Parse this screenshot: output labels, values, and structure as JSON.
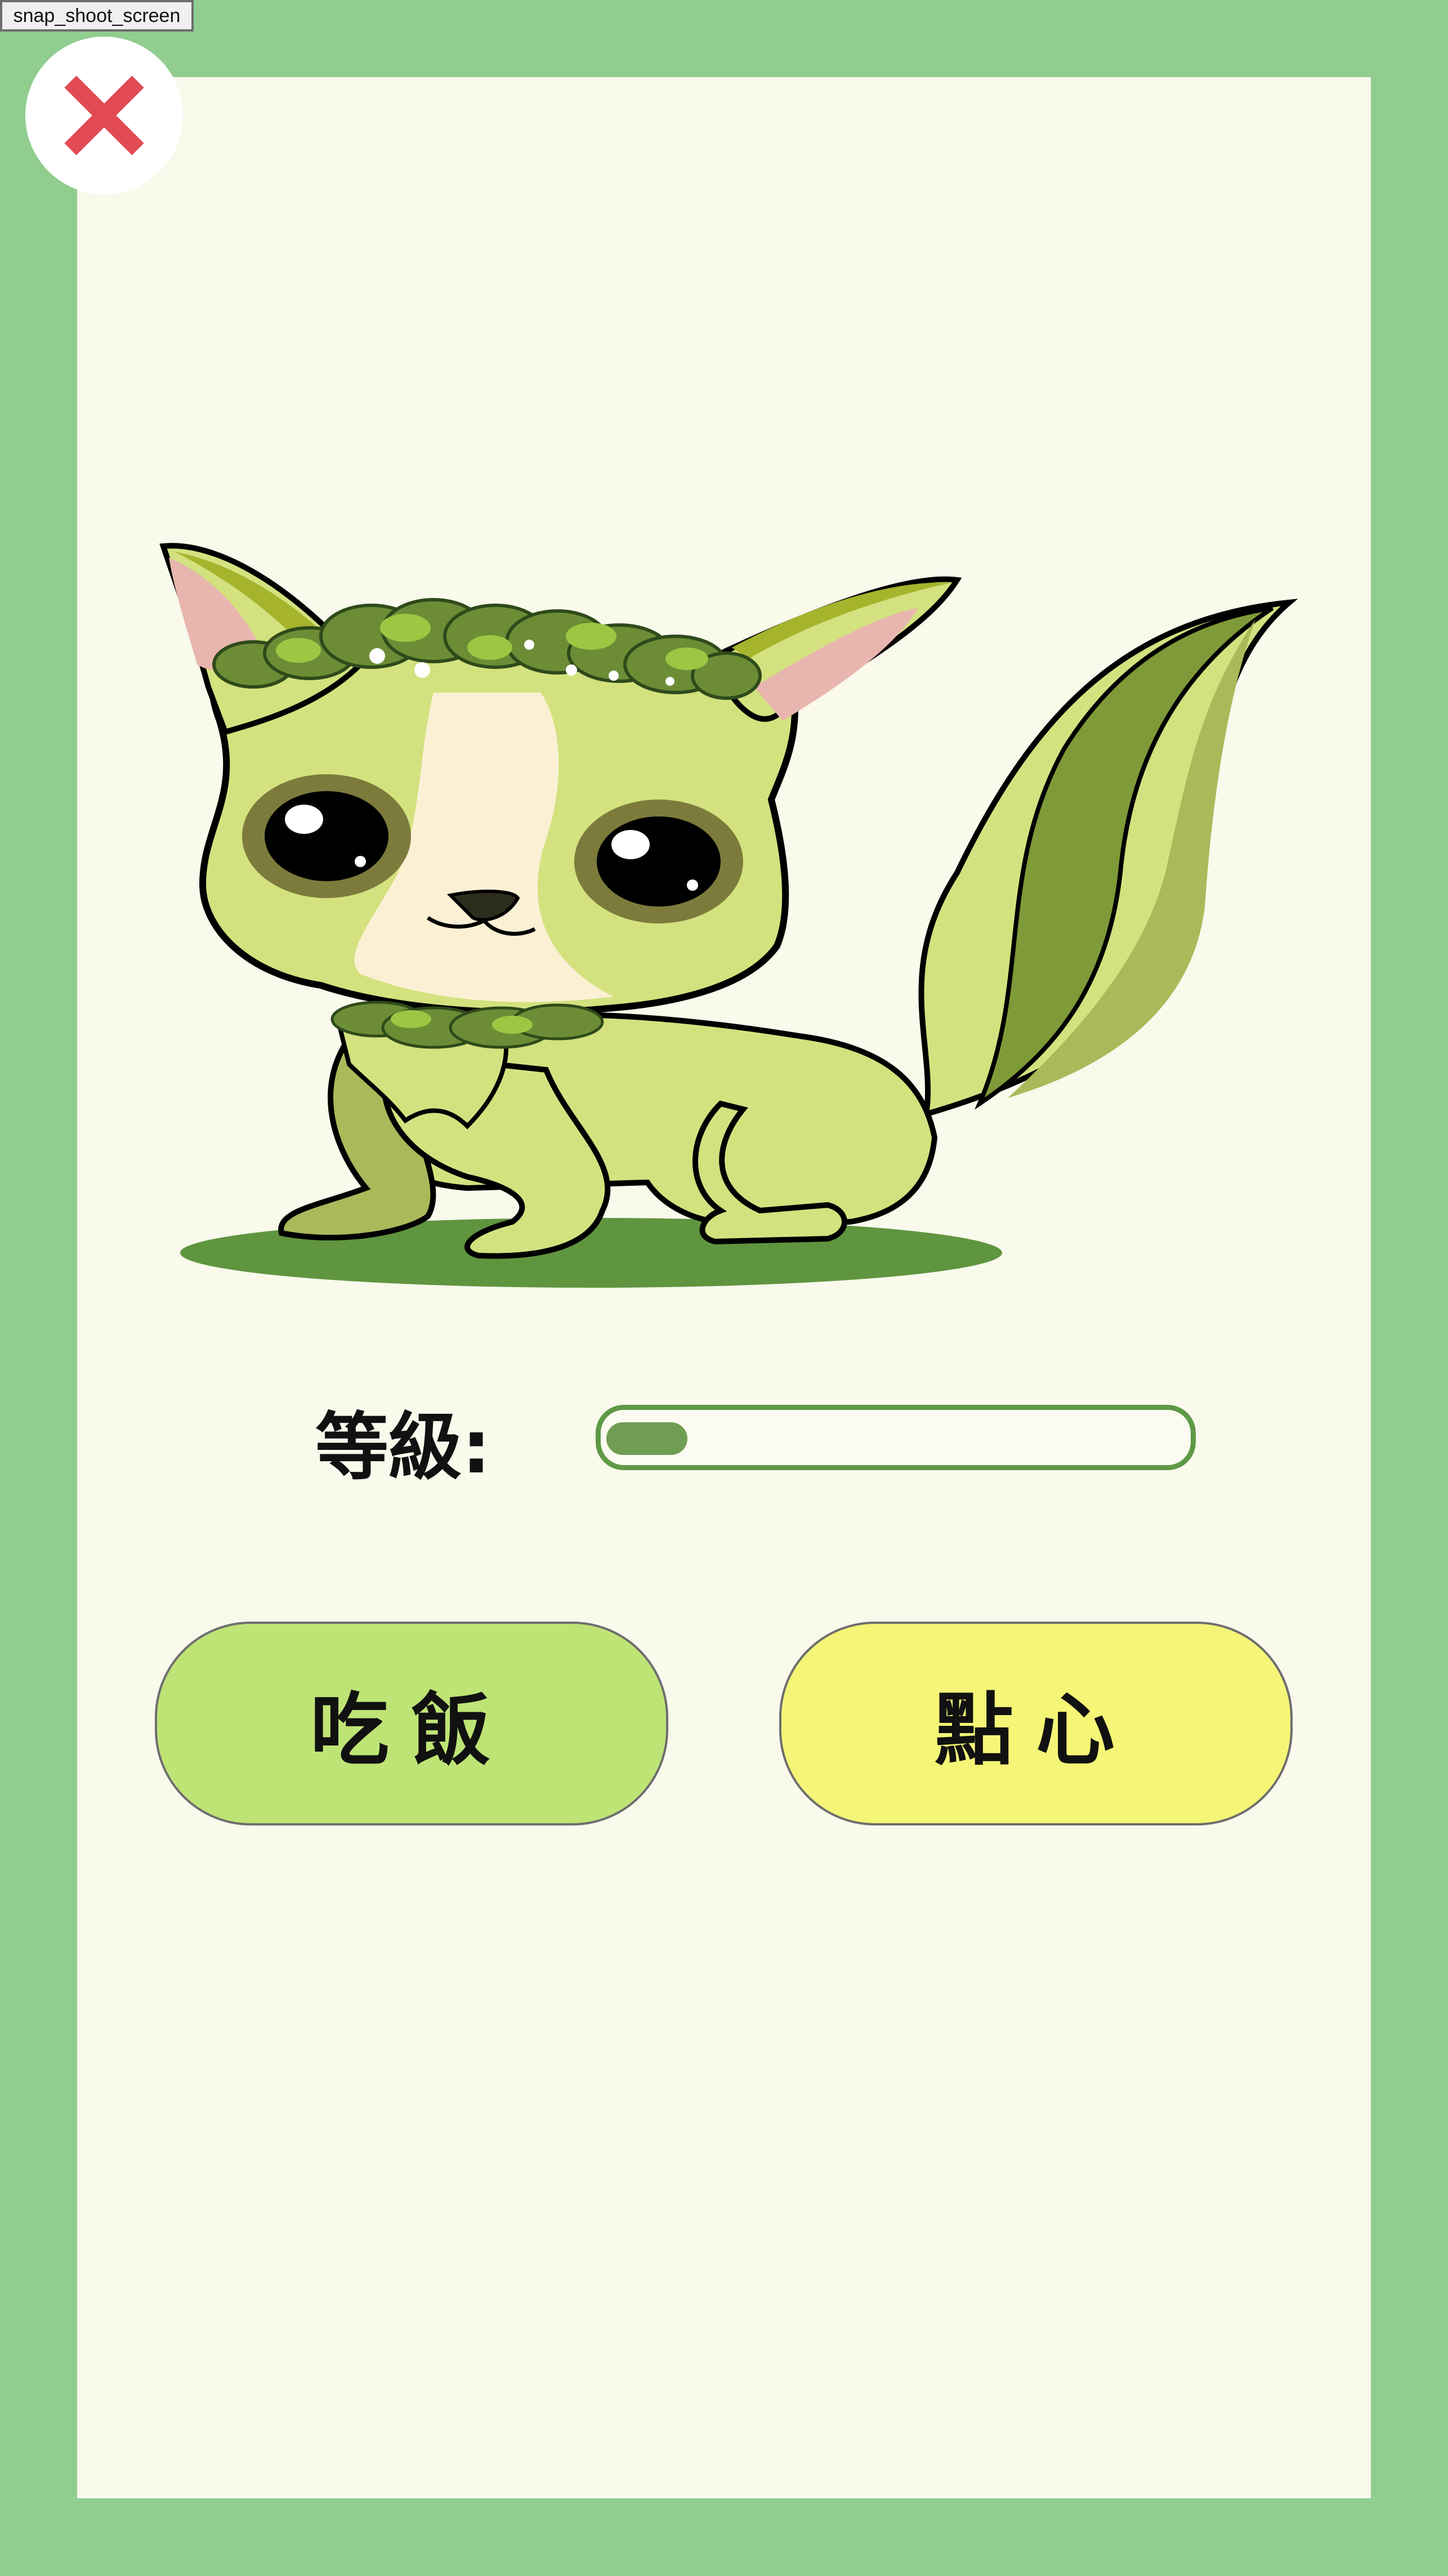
{
  "toolbar": {
    "snapshot_label": "snap_shoot_screen"
  },
  "close": {
    "icon": "close-icon",
    "color": "#e24b55"
  },
  "pet": {
    "description_icon": "green-leaf-fox-creature"
  },
  "level": {
    "label": "等級:",
    "progress": 0.14,
    "fill_color": "#6f9d52",
    "border_color": "#5e9946"
  },
  "actions": {
    "eat_label": "吃飯",
    "snack_label": "點心",
    "eat_color": "#bee476",
    "snack_color": "#f5f577"
  },
  "colors": {
    "background": "#90cd8e",
    "card": "#f9f9ec"
  }
}
